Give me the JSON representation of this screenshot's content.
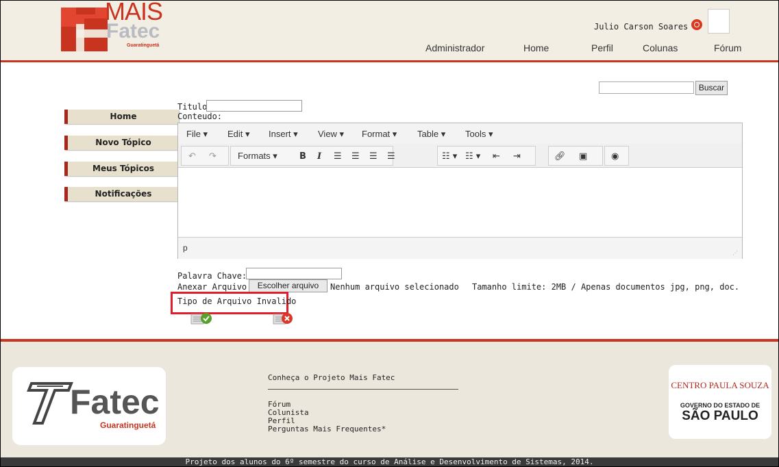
{
  "header": {
    "logo_mais": "MAIS",
    "logo_fatec": "Fatec",
    "logo_sub": "Guaratinguetá",
    "user_name": "Julio Carson Soares",
    "nav": [
      "Administrador",
      "Home",
      "Perfil",
      "Colunas",
      "Fórum"
    ]
  },
  "search": {
    "value": "",
    "button": "Buscar"
  },
  "sidebar": {
    "items": [
      {
        "label": "Home"
      },
      {
        "label": "Novo Tópico"
      },
      {
        "label": "Meus Tópicos"
      },
      {
        "label": "Notificações"
      }
    ]
  },
  "form": {
    "title_label": "Titulo:",
    "title_value": "",
    "content_label": "Conteudo:",
    "editor": {
      "menus": [
        "File ▾",
        "Edit ▾",
        "Insert ▾",
        "View ▾",
        "Format ▾",
        "Table ▾",
        "Tools ▾"
      ],
      "formats_label": "Formats ▾",
      "status_path": "p"
    },
    "keyword_label": "Palavra Chave:",
    "keyword_value": "",
    "attach_label": "Anexar Arquivo:",
    "choose_file": "Escolher arquivo",
    "no_file": "Nenhum arquivo selecionado",
    "limit_text": "Tamanho limite: 2MB / Apenas documentos jpg, png, doc.",
    "error_text": "Tipo de Arquivo Invalido"
  },
  "footer": {
    "about": "Conheça o Projeto Mais Fatec",
    "links": [
      "Fórum",
      "Colunista",
      "Perfil",
      "Perguntas Mais Frequentes*"
    ],
    "fatec_logo_text": "Fatec",
    "fatec_logo_sub": "Guaratinguetá",
    "cps_line1": "CENTRO PAULA SOUZA",
    "cps_line2": "GOVERNO DO ESTADO DE",
    "cps_line3": "SÃO PAULO",
    "credits": "Projeto dos alunos do 6º semestre do curso de Análise e Desenvolvimento de Sistemas, 2014."
  },
  "colors": {
    "brand_red": "#c8341f",
    "error_red": "#e11d2b",
    "header_bg": "#f3eee4",
    "sidebar_bg": "#e6e0cd"
  }
}
